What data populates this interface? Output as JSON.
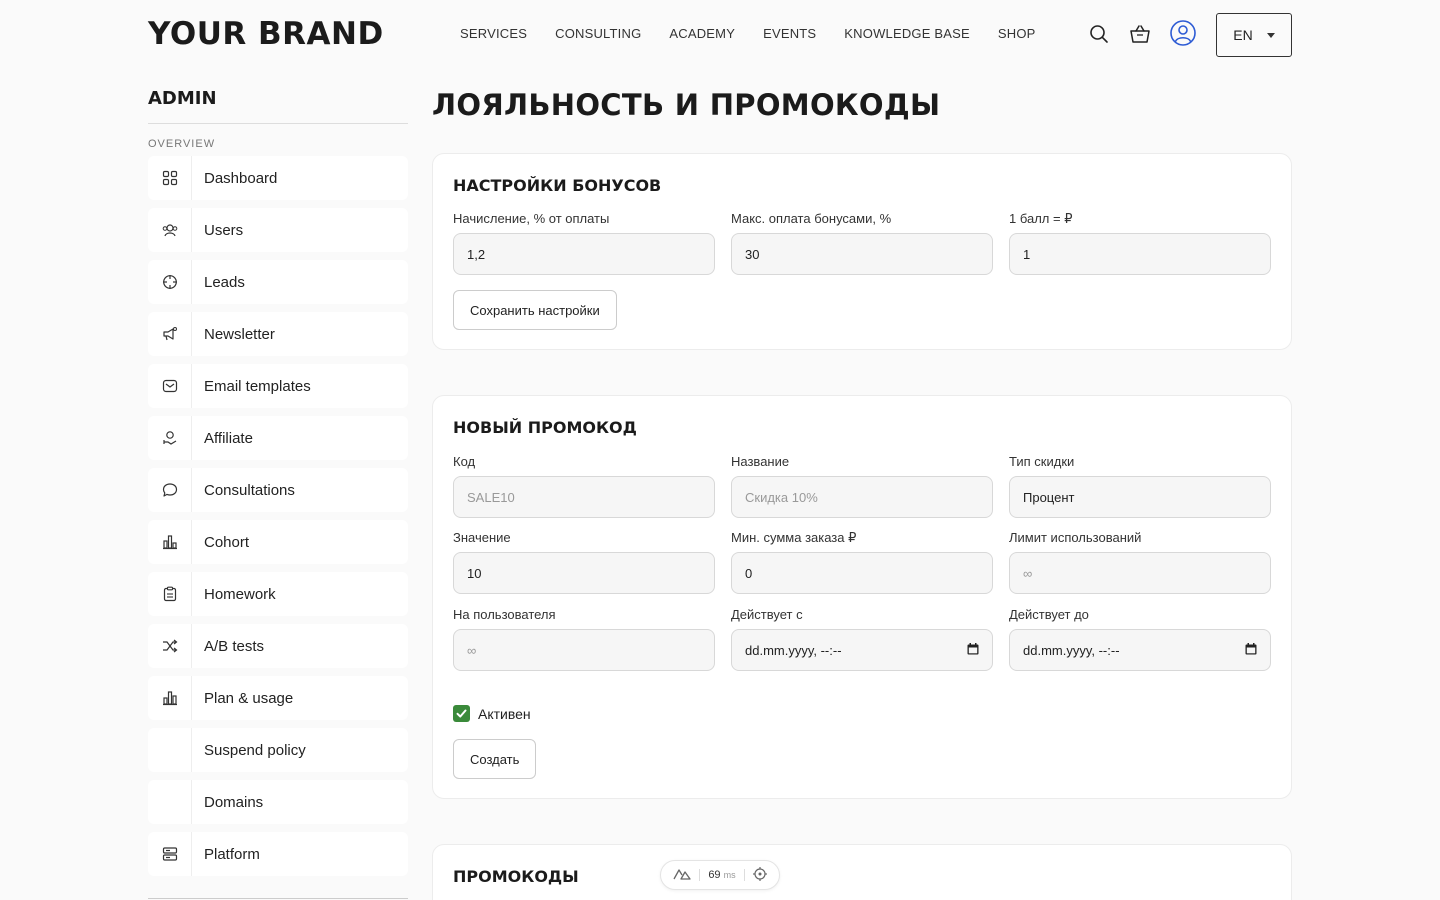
{
  "header": {
    "brand": "YOUR BRAND",
    "nav": [
      "SERVICES",
      "CONSULTING",
      "ACADEMY",
      "EVENTS",
      "KNOWLEDGE BASE",
      "SHOP"
    ],
    "lang": "EN",
    "icons": [
      "search-icon",
      "cart-icon",
      "user-icon"
    ]
  },
  "sidebar": {
    "title": "ADMIN",
    "section": "OVERVIEW",
    "items": [
      {
        "label": "Dashboard",
        "icon": "grid-icon"
      },
      {
        "label": "Users",
        "icon": "users-icon"
      },
      {
        "label": "Leads",
        "icon": "target-icon"
      },
      {
        "label": "Newsletter",
        "icon": "megaphone-icon"
      },
      {
        "label": "Email templates",
        "icon": "mail-icon"
      },
      {
        "label": "Affiliate",
        "icon": "affiliate-icon"
      },
      {
        "label": "Consultations",
        "icon": "chat-icon"
      },
      {
        "label": "Cohort",
        "icon": "bars-icon"
      },
      {
        "label": "Homework",
        "icon": "clipboard-icon"
      },
      {
        "label": "A/B tests",
        "icon": "shuffle-icon"
      },
      {
        "label": "Plan & usage",
        "icon": "chart-icon"
      },
      {
        "label": "Suspend policy",
        "icon": ""
      },
      {
        "label": "Domains",
        "icon": ""
      },
      {
        "label": "Platform",
        "icon": "server-icon"
      }
    ]
  },
  "main": {
    "title": "ЛОЯЛЬНОСТЬ И ПРОМОКОДЫ",
    "bonus": {
      "title": "НАСТРОЙКИ БОНУСОВ",
      "accrual_label": "Начисление, % от оплаты",
      "accrual_value": "1,2",
      "max_label": "Макс. оплата бонусами, %",
      "max_value": "30",
      "point_label": "1 балл = ₽",
      "point_value": "1",
      "save_label": "Сохранить настройки"
    },
    "promo": {
      "title": "НОВЫЙ ПРОМОКОД",
      "code_label": "Код",
      "code_placeholder": "SALE10",
      "name_label": "Название",
      "name_placeholder": "Скидка 10%",
      "type_label": "Тип скидки",
      "type_value": "Процент",
      "value_label": "Значение",
      "value_value": "10",
      "min_label": "Мин. сумма заказа ₽",
      "min_value": "0",
      "limit_label": "Лимит использований",
      "limit_placeholder": "∞",
      "per_user_label": "На пользователя",
      "per_user_placeholder": "∞",
      "from_label": "Действует с",
      "from_placeholder": "dd.mm.yyyy, --:--",
      "to_label": "Действует до",
      "to_placeholder": "dd.mm.yyyy, --:--",
      "active_label": "Активен",
      "create_label": "Создать"
    },
    "list": {
      "title": "ПРОМОКОДЫ"
    }
  },
  "devbar": {
    "time": "69",
    "unit": "ms"
  }
}
